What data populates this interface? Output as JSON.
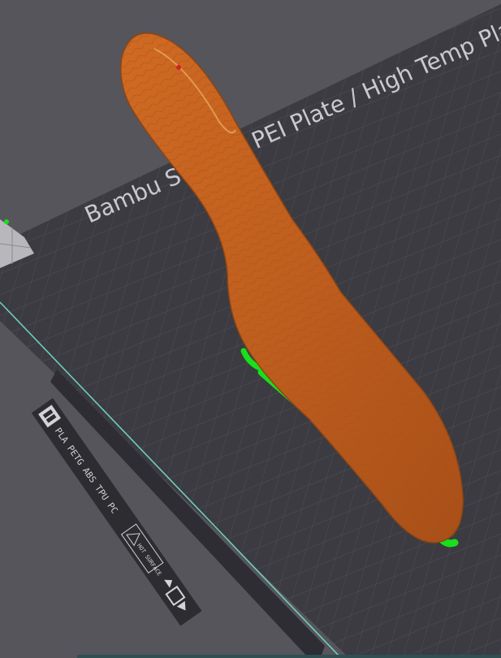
{
  "viewport": {
    "background_color": "#55555b",
    "plate_color": "#3a3a40",
    "grid_color": "#4b4b52",
    "plate_edge_color": "#6fcfb7",
    "model_color": "#c2601f",
    "support_color": "#18e01a"
  },
  "plate": {
    "title_text": "Bambu Smooth PEI Plate / High Temp Plate",
    "label_materials": "PLA PETG ABS TPU PC",
    "warning_label": "HOT SURFACE",
    "logo_icon": "bambu-logo-icon",
    "orientation_icon": "plate-orientation-icon"
  },
  "model": {
    "name": "insole-model"
  }
}
